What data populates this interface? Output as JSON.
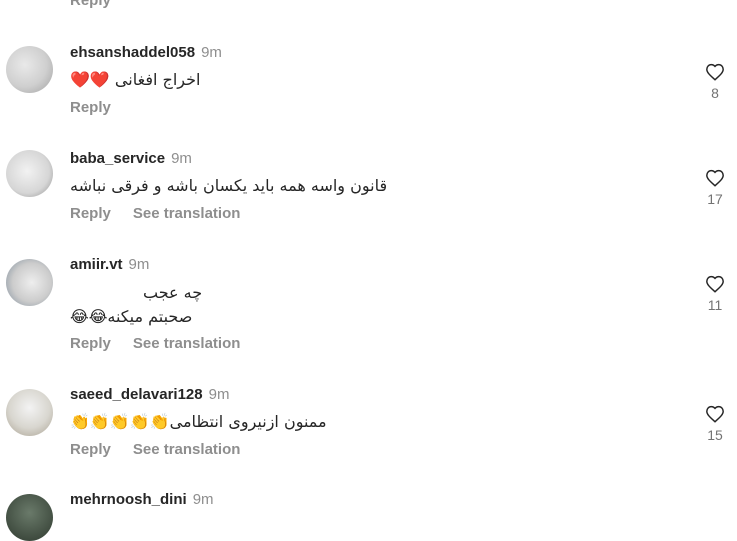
{
  "top": {
    "reply_label": "Reply"
  },
  "comments": [
    {
      "username": "ehsanshaddel058",
      "time": "9m",
      "text": "اخراج افغانی ❤️❤️",
      "reply_label": "Reply",
      "like_count": "8"
    },
    {
      "username": "baba_service",
      "time": "9m",
      "text": "قانون واسه همه باید یکسان باشه و فرقی نباشه",
      "reply_label": "Reply",
      "translate_label": "See translation",
      "like_count": "17"
    },
    {
      "username": "amiir.vt",
      "time": "9m",
      "text_line1": "چه عجب",
      "text_line2": "صحبتم میکنه😂😂",
      "reply_label": "Reply",
      "translate_label": "See translation",
      "like_count": "11"
    },
    {
      "username": "saeed_delavari128",
      "time": "9m",
      "text": "ممنون ازنیروی انتظامی👏👏👏👏👏",
      "reply_label": "Reply",
      "translate_label": "See translation",
      "like_count": "15"
    },
    {
      "username": "mehrnoosh_dini",
      "time": "9m"
    }
  ],
  "icons": {
    "like": "heart-outline-icon"
  },
  "colors": {
    "text": "#262626",
    "secondary": "#8e8e8e",
    "background": "#ffffff"
  }
}
